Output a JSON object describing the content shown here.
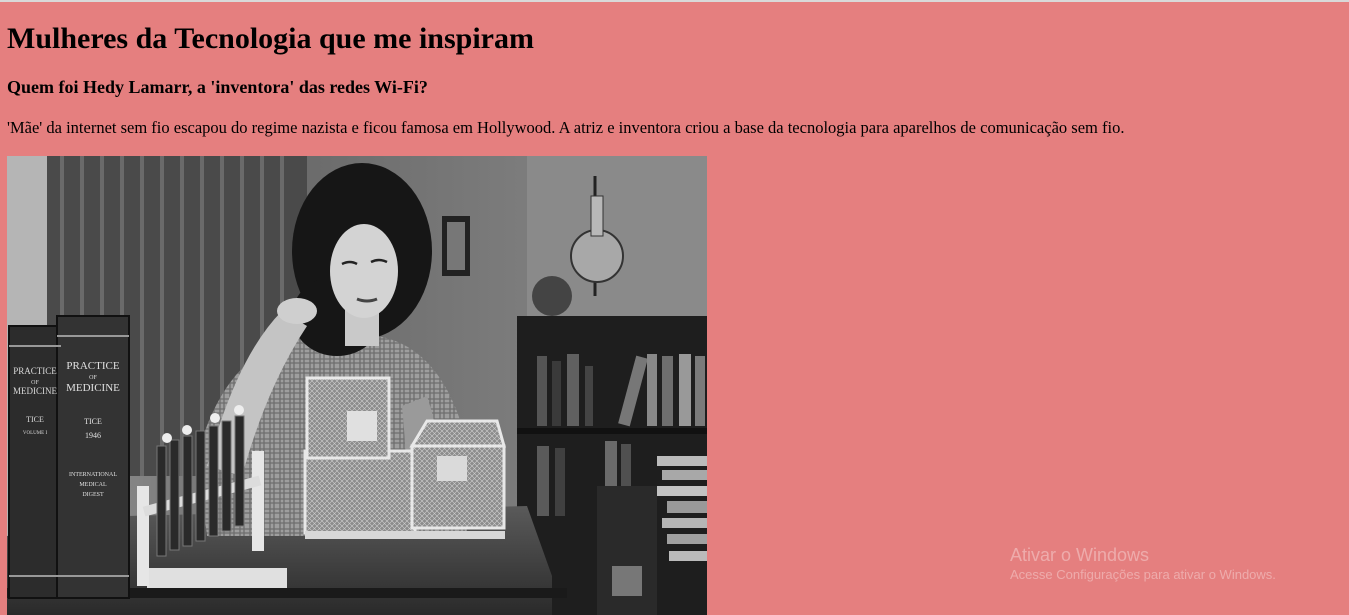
{
  "page": {
    "title": "Mulheres da Tecnologia que me inspiram",
    "subtitle": "Quem foi Hedy Lamarr, a 'inventora' das redes Wi-Fi?",
    "paragraph": "'Mãe' da internet sem fio escapou do regime nazista e ficou famosa em Hollywood. A atriz e inventora criou a base da tecnologia para aparelhos de comunicação sem fio.",
    "background_color": "#e57f7f"
  },
  "photo": {
    "book1_spine": [
      "PRACTICE",
      "OF",
      "MEDICINE",
      "TICE",
      "VOLUME I"
    ],
    "book2_spine": [
      "PRACTICE",
      "OF",
      "MEDICINE",
      "TICE",
      "1946",
      "INTERNATIONAL",
      "MEDICAL",
      "DIGEST"
    ]
  },
  "os_overlay": {
    "watermark_title": "Ativar o Windows",
    "watermark_subtitle": "Acesse Configurações para ativar o Windows."
  }
}
